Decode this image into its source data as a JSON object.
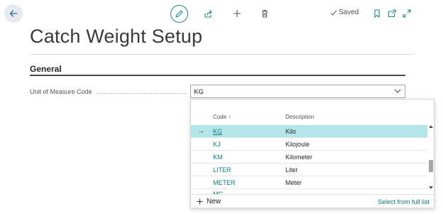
{
  "toolbar": {
    "saved_label": "Saved"
  },
  "page": {
    "title": "Catch Weight Setup",
    "section": "General"
  },
  "field": {
    "label": "Unit of Measure Code",
    "value": "KG"
  },
  "lookup": {
    "col_code": "Code ↑",
    "col_desc": "Description",
    "rows": [
      {
        "code": "KG",
        "desc": "Kilo"
      },
      {
        "code": "KJ",
        "desc": "Kilojoule"
      },
      {
        "code": "KM",
        "desc": "Kilometer"
      },
      {
        "code": "LITER",
        "desc": "Liter"
      },
      {
        "code": "METER",
        "desc": "Meter"
      }
    ],
    "partial_row_code": "MG",
    "selected_arrow": "→",
    "new_label": "New",
    "full_list_label": "Select from full list"
  }
}
